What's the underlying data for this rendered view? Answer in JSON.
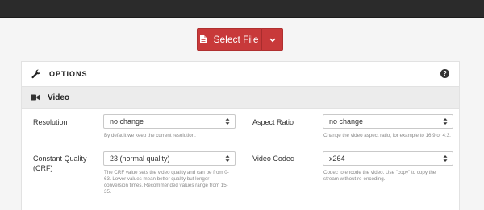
{
  "upload": {
    "select_file_label": "Select File"
  },
  "options": {
    "title": "OPTIONS",
    "help_glyph": "?"
  },
  "video": {
    "title": "Video",
    "resolution": {
      "label": "Resolution",
      "value": "no change",
      "help": "By default we keep the current resolution."
    },
    "aspect_ratio": {
      "label": "Aspect Ratio",
      "value": "no change",
      "help": "Change the video aspect ratio, for example to 16:9 or 4:3."
    },
    "quality": {
      "label_line1": "Constant Quality",
      "label_line2": "(CRF)",
      "value": "23 (normal quality)",
      "help_line1": "The CRF value sets the video quality and can be from 0-",
      "help_line2": "63. Lower values mean better quality but longer",
      "help_line3": "conversion times. Recommended values range from 15-",
      "help_line4": "35."
    },
    "codec": {
      "label": "Video Codec",
      "value": "x264",
      "help_line1": "Codec to encode the video. Use \"copy\" to copy the",
      "help_line2": "stream without re-encoding."
    }
  },
  "colors": {
    "accent": "#c8393a",
    "topbar": "#2b2b2b",
    "section_bg": "#ececec"
  }
}
